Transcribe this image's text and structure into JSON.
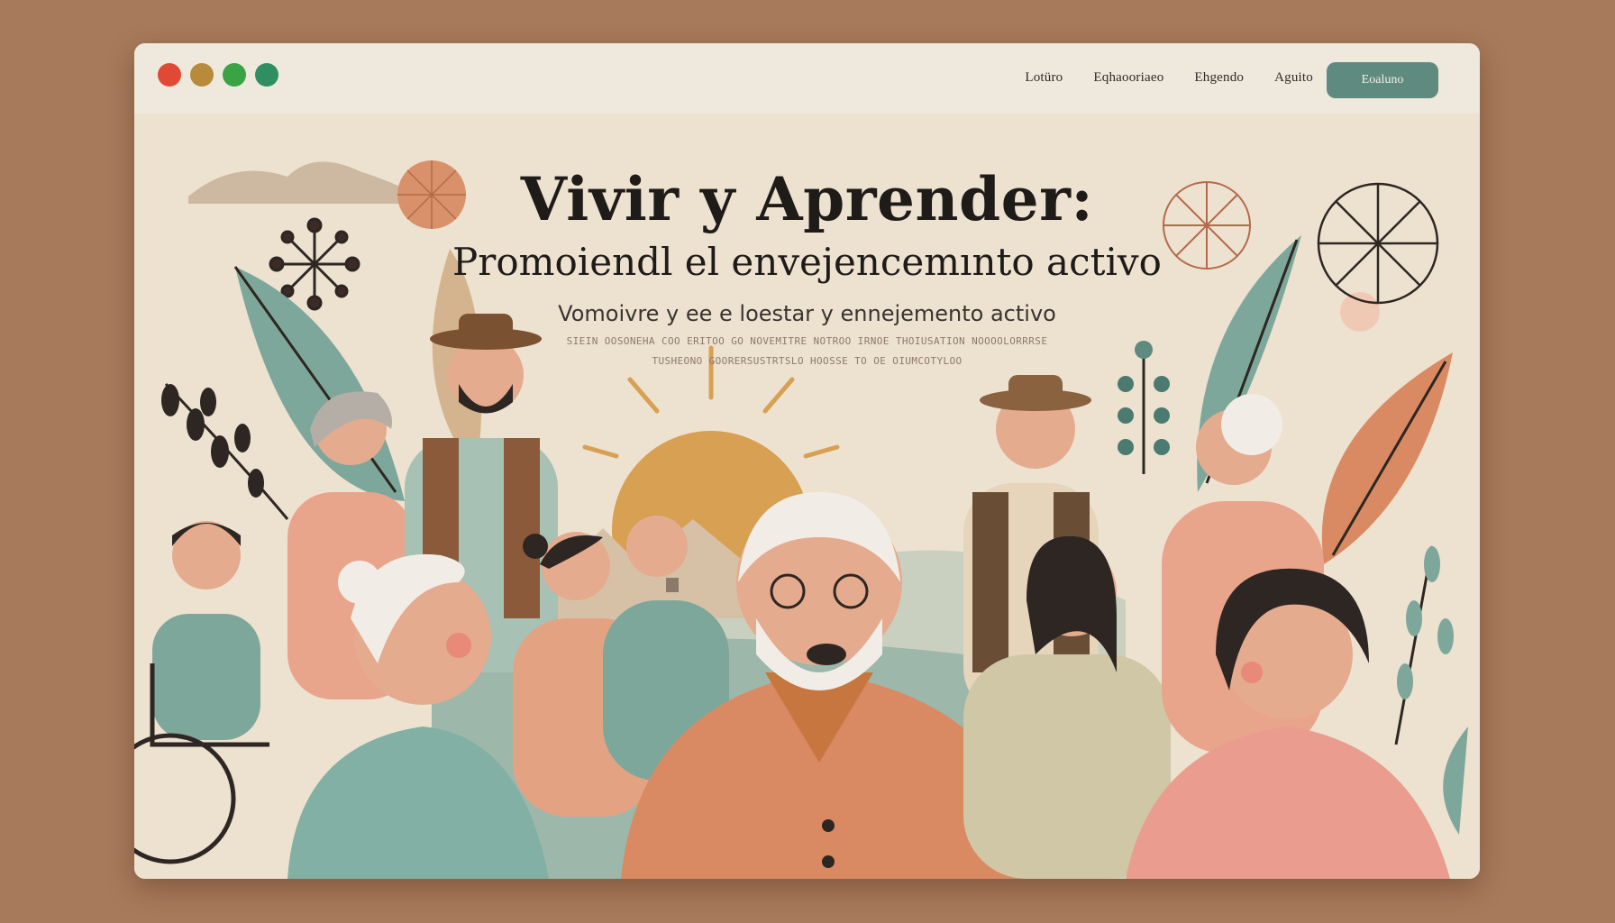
{
  "window": {
    "traffic_lights": [
      "#e04a35",
      "#b78b3a",
      "#3aa345",
      "#2f8f62"
    ]
  },
  "nav": {
    "links": [
      "Lotüro",
      "Eqhaooriaeo",
      "Ehgendo",
      "Aguito"
    ],
    "cta_label": "Eoaluno",
    "cta_color": "#5e8a7f"
  },
  "hero": {
    "title_line1": "Vivir y Aprender:",
    "title_line2": "Promoiendl el envejencemınto activo",
    "subtitle": "Vomoivre y ee e loestar y ennejemento activo",
    "microtext_line1": "SIEIN OOSONEHA COO ERITOO GO NOVEMITRE NOTROO IRNOE THOIUSATION NOOOOLORRRSE",
    "microtext_line2": "TUSHEONO GOORERSUSTRTSLO HOOSSE TO OE OIUMCOTYLOO"
  },
  "colors": {
    "background": "#a87a5c",
    "hero_bg": "#ede2d0",
    "sage": "#7ea79b",
    "terracotta": "#d98a62",
    "peach": "#e9a48c",
    "mustard": "#d7a052"
  }
}
